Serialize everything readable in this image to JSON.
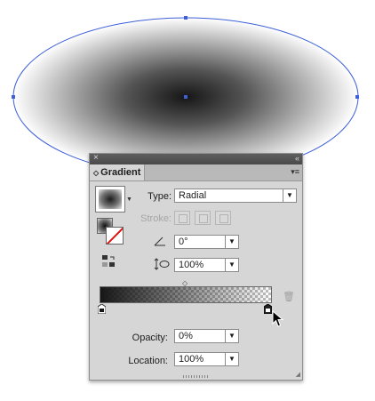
{
  "canvas": {
    "object": "ellipse",
    "selection_color": "#3d5fd8",
    "fill": "radial gradient"
  },
  "panel": {
    "title_close_icon": "×",
    "title_collapse_icon": "«",
    "tab_label": "Gradient",
    "tab_arrows": "◇",
    "menu_icon": "▾≡",
    "type_label": "Type:",
    "type_value": "Radial",
    "stroke_label": "Stroke:",
    "angle_value": "0°",
    "aspect_value": "100%",
    "opacity_label": "Opacity:",
    "opacity_value": "0%",
    "location_label": "Location:",
    "location_value": "100%"
  },
  "gradient_ramp": {
    "start_color": "#161616",
    "end_opacity_percent": 0,
    "stops": [
      {
        "color": "#161616",
        "location_percent": 0,
        "selected": false
      },
      {
        "color": "#161616",
        "location_percent": 100,
        "selected": true
      }
    ]
  },
  "icons": [
    "close-icon",
    "collapse-icon",
    "panel-menu-icon",
    "angle-icon",
    "aspect-ratio-icon",
    "reverse-gradient-icon",
    "delete-stop-icon",
    "pointer-cursor-icon"
  ]
}
